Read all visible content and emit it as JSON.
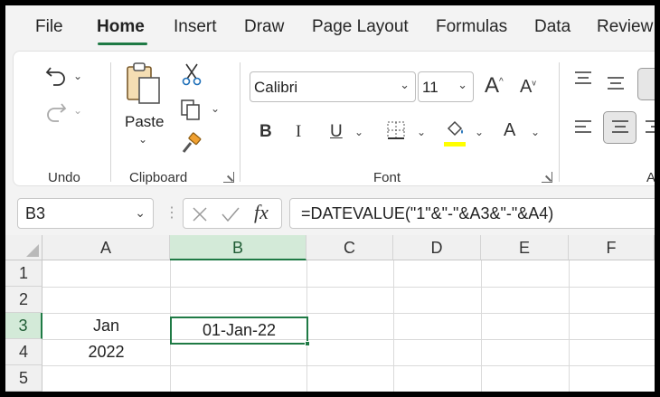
{
  "menu": {
    "tabs": [
      {
        "label": "File",
        "active": false
      },
      {
        "label": "Home",
        "active": true
      },
      {
        "label": "Insert",
        "active": false
      },
      {
        "label": "Draw",
        "active": false
      },
      {
        "label": "Page Layout",
        "active": false
      },
      {
        "label": "Formulas",
        "active": false
      },
      {
        "label": "Data",
        "active": false
      },
      {
        "label": "Review",
        "active": false
      }
    ]
  },
  "ribbon": {
    "undo_group": {
      "label": "Undo",
      "icons": [
        "undo-icon",
        "redo-icon"
      ]
    },
    "clipboard_group": {
      "label": "Clipboard",
      "paste_label": "Paste",
      "icons": [
        "paste-icon",
        "cut-icon",
        "copy-icon",
        "format-painter-icon"
      ]
    },
    "font_group": {
      "label": "Font",
      "font_name": "Calibri",
      "font_size": "11",
      "increase_font_glyph": "A",
      "decrease_font_glyph": "A",
      "bold_glyph": "B",
      "italic_glyph": "I",
      "underline_glyph": "U",
      "font_color_glyph": "A",
      "highlight_color": "#ffff00"
    },
    "alignment_group": {
      "label": "Al"
    }
  },
  "formula_bar": {
    "name_box": "B3",
    "formula": "=DATEVALUE(\"1\"&\"-\"&A3&\"-\"&A4)"
  },
  "sheet": {
    "columns": [
      "A",
      "B",
      "C",
      "D",
      "E",
      "F"
    ],
    "rows": [
      "1",
      "2",
      "3",
      "4",
      "5"
    ],
    "selected_column": "B",
    "selected_row": "3",
    "cells": {
      "A3": "Jan",
      "A4": "2022",
      "B3": "01-Jan-22"
    }
  },
  "colors": {
    "accent": "#1f7a45",
    "selection_header": "#d3ead8"
  }
}
